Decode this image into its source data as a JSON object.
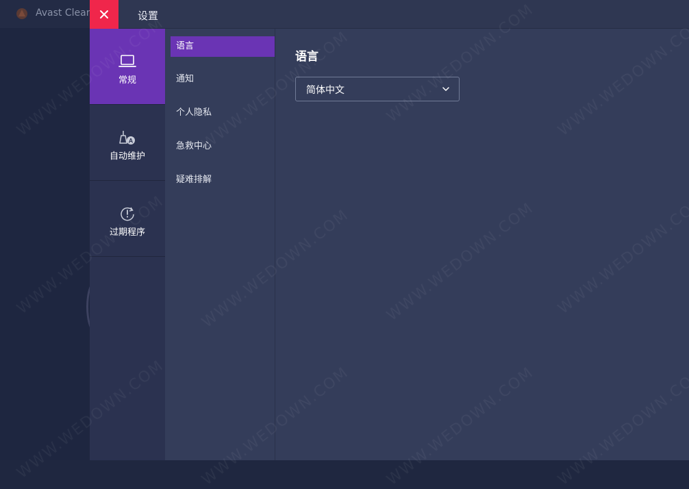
{
  "background_app": {
    "title": "Avast Clean"
  },
  "settings": {
    "title": "设置",
    "close_icon": "close-icon",
    "categories": [
      {
        "label": "常规",
        "icon": "laptop-icon",
        "active": true
      },
      {
        "label": "自动维护",
        "icon": "broom-auto-icon",
        "active": false
      },
      {
        "label": "过期程序",
        "icon": "refresh-alert-icon",
        "active": false
      }
    ],
    "sub_items": [
      {
        "label": "语言",
        "active": true
      },
      {
        "label": "通知",
        "active": false
      },
      {
        "label": "个人隐私",
        "active": false
      },
      {
        "label": "急救中心",
        "active": false
      },
      {
        "label": "疑难排解",
        "active": false
      }
    ],
    "section": {
      "title": "语言",
      "language_select": {
        "value": "简体中文"
      }
    }
  },
  "watermark": "WWW.WEDOWN.COM",
  "colors": {
    "accent": "#6a34b4",
    "close": "#f0264b",
    "panel": "#343d5a"
  }
}
